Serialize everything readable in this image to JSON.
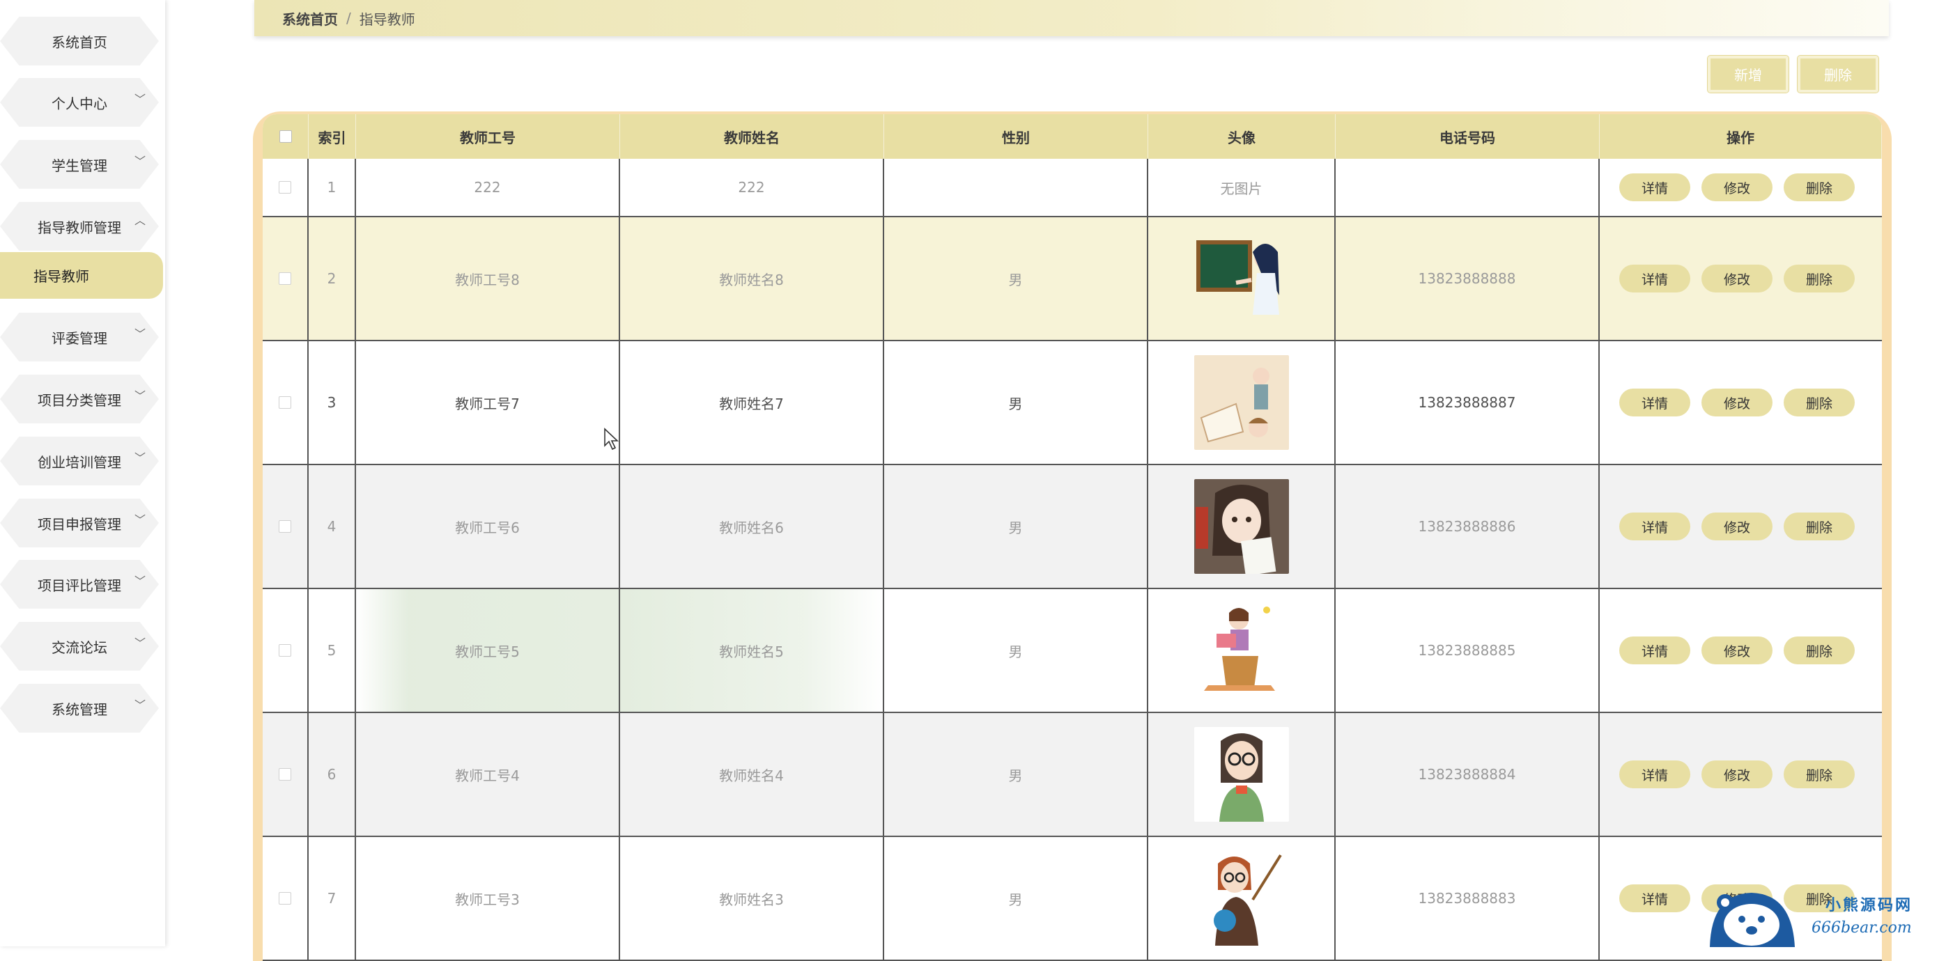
{
  "sidebar": {
    "items": [
      {
        "label": "系统首页",
        "expandable": false
      },
      {
        "label": "个人中心",
        "expandable": true
      },
      {
        "label": "学生管理",
        "expandable": true
      },
      {
        "label": "指导教师管理",
        "expandable": true,
        "expanded": true
      },
      {
        "label": "指导教师",
        "sub": true,
        "active": true
      },
      {
        "label": "评委管理",
        "expandable": true
      },
      {
        "label": "项目分类管理",
        "expandable": true
      },
      {
        "label": "创业培训管理",
        "expandable": true
      },
      {
        "label": "项目申报管理",
        "expandable": true
      },
      {
        "label": "项目评比管理",
        "expandable": true
      },
      {
        "label": "交流论坛",
        "expandable": true
      },
      {
        "label": "系统管理",
        "expandable": true
      }
    ]
  },
  "breadcrumb": {
    "home": "系统首页",
    "separator": "/",
    "current": "指导教师"
  },
  "toolbar": {
    "add_label": "新增",
    "delete_label": "删除"
  },
  "table": {
    "headers": [
      "索引",
      "教师工号",
      "教师姓名",
      "性别",
      "头像",
      "电话号码",
      "操作"
    ],
    "rows": [
      {
        "index": "1",
        "no": "222",
        "name": "222",
        "sex": "",
        "avatar_text": "无图片",
        "tel": ""
      },
      {
        "index": "2",
        "no": "教师工号8",
        "name": "教师姓名8",
        "sex": "男",
        "avatar": "teacher-blackboard",
        "tel": "13823888888"
      },
      {
        "index": "3",
        "no": "教师工号7",
        "name": "教师姓名7",
        "sex": "男",
        "avatar": "teacher-reading",
        "tel": "13823888887"
      },
      {
        "index": "4",
        "no": "教师工号6",
        "name": "教师姓名6",
        "sex": "男",
        "avatar": "teacher-paper",
        "tel": "13823888886"
      },
      {
        "index": "5",
        "no": "教师工号5",
        "name": "教师姓名5",
        "sex": "男",
        "avatar": "teacher-podium",
        "tel": "13823888885"
      },
      {
        "index": "6",
        "no": "教师工号4",
        "name": "教师姓名4",
        "sex": "男",
        "avatar": "teacher-glasses",
        "tel": "13823888884"
      },
      {
        "index": "7",
        "no": "教师工号3",
        "name": "教师姓名3",
        "sex": "男",
        "avatar": "teacher-globe",
        "tel": "13823888883"
      }
    ],
    "actions": {
      "detail": "详情",
      "edit": "修改",
      "delete": "删除"
    }
  },
  "logo": {
    "top_text": "小熊源码网",
    "bottom_text": "666bear.com"
  },
  "colors": {
    "accent": "#e8dfa3",
    "table_frame": "#f8ddad",
    "row_highlight": "#f7f3d7",
    "row_grey": "#f2f2f2"
  }
}
